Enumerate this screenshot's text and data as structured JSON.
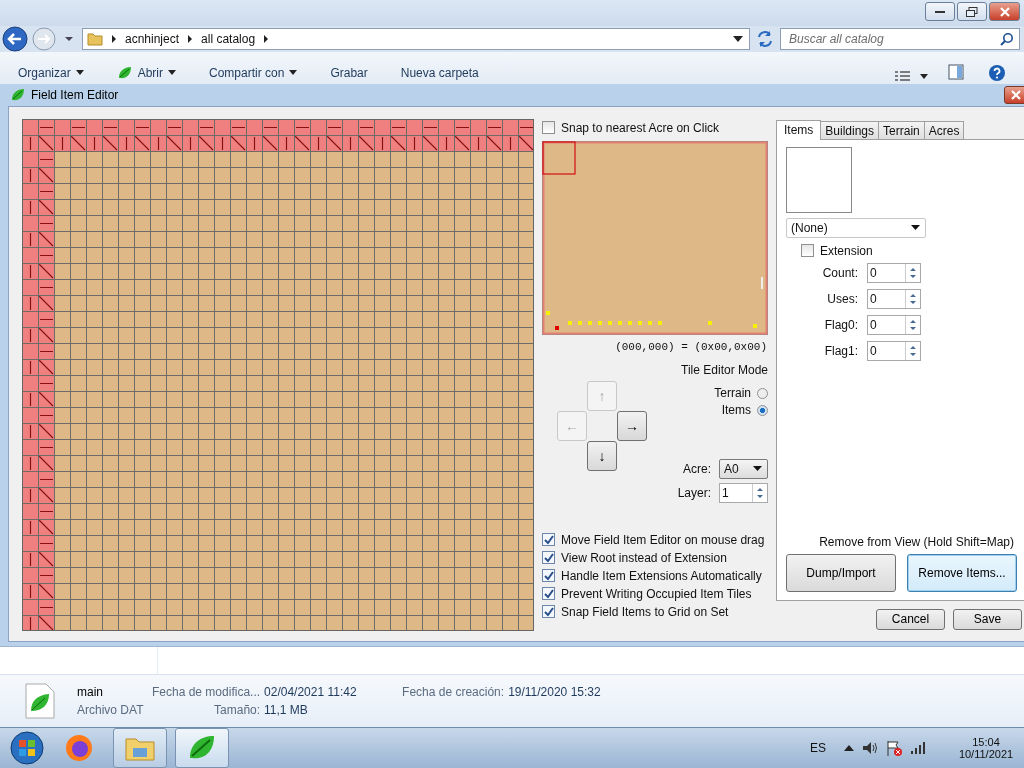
{
  "explorer": {
    "breadcrumbs": [
      "acnhinject",
      "all catalog"
    ],
    "search": {
      "placeholder": "Buscar all catalog"
    },
    "toolbar": [
      {
        "label": "Organizar",
        "dropdown": true
      },
      {
        "label": "Abrir",
        "dropdown": true
      },
      {
        "label": "Compartir con",
        "dropdown": true
      },
      {
        "label": "Grabar",
        "dropdown": false
      },
      {
        "label": "Nueva carpeta",
        "dropdown": false
      }
    ]
  },
  "dialog": {
    "title": "Field Item Editor",
    "snap_to_acre": {
      "label": "Snap to nearest Acre on Click",
      "checked": false
    },
    "coordinates": "(000,000) = (0x00,0x00)",
    "tile_editor_mode": {
      "label": "Tile Editor Mode",
      "options": [
        {
          "label": "Terrain",
          "selected": false
        },
        {
          "label": "Items",
          "selected": true
        }
      ]
    },
    "arrows": [
      {
        "glyph": "↑",
        "disabled": true
      },
      {
        "glyph": "←",
        "disabled": true
      },
      {
        "glyph": "→",
        "disabled": false
      },
      {
        "glyph": "↓",
        "disabled": false
      }
    ],
    "acre": {
      "label": "Acre:",
      "value": "A0"
    },
    "layer": {
      "label": "Layer:",
      "value": "1"
    },
    "options": [
      {
        "label": "Move Field Item Editor on mouse drag",
        "checked": true
      },
      {
        "label": "View Root instead of Extension",
        "checked": true
      },
      {
        "label": "Handle Item Extensions Automatically",
        "checked": true
      },
      {
        "label": "Prevent Writing Occupied Item Tiles",
        "checked": true
      },
      {
        "label": "Snap Field Items to Grid on Set",
        "checked": true
      }
    ],
    "tabs": [
      {
        "label": "Items",
        "selected": true
      },
      {
        "label": "Buildings",
        "selected": false
      },
      {
        "label": "Terrain",
        "selected": false
      },
      {
        "label": "Acres",
        "selected": false
      }
    ],
    "item_select": "(None)",
    "extension": {
      "label": "Extension",
      "checked": false
    },
    "fields": [
      {
        "label": "Count:",
        "value": "0"
      },
      {
        "label": "Uses:",
        "value": "0"
      },
      {
        "label": "Flag0:",
        "value": "0"
      },
      {
        "label": "Flag1:",
        "value": "0"
      }
    ],
    "remove_hint": "Remove from View (Hold Shift=Map)",
    "panel_buttons": [
      {
        "label": "Dump/Import",
        "focused": false
      },
      {
        "label": "Remove Items...",
        "focused": true
      }
    ],
    "buttons": [
      "Cancel",
      "Save"
    ]
  },
  "details": {
    "name": "main",
    "type": "Archivo DAT",
    "properties": [
      {
        "label": "Fecha de modifica...",
        "value": "02/04/2021 11:42"
      },
      {
        "label": "Fecha de creación:",
        "value": "19/11/2020 15:32"
      },
      {
        "label": "Tamaño:",
        "value": "11,1 MB"
      }
    ]
  },
  "taskbar": {
    "language": "ES",
    "time": "15:04",
    "date": "10/11/2021"
  }
}
